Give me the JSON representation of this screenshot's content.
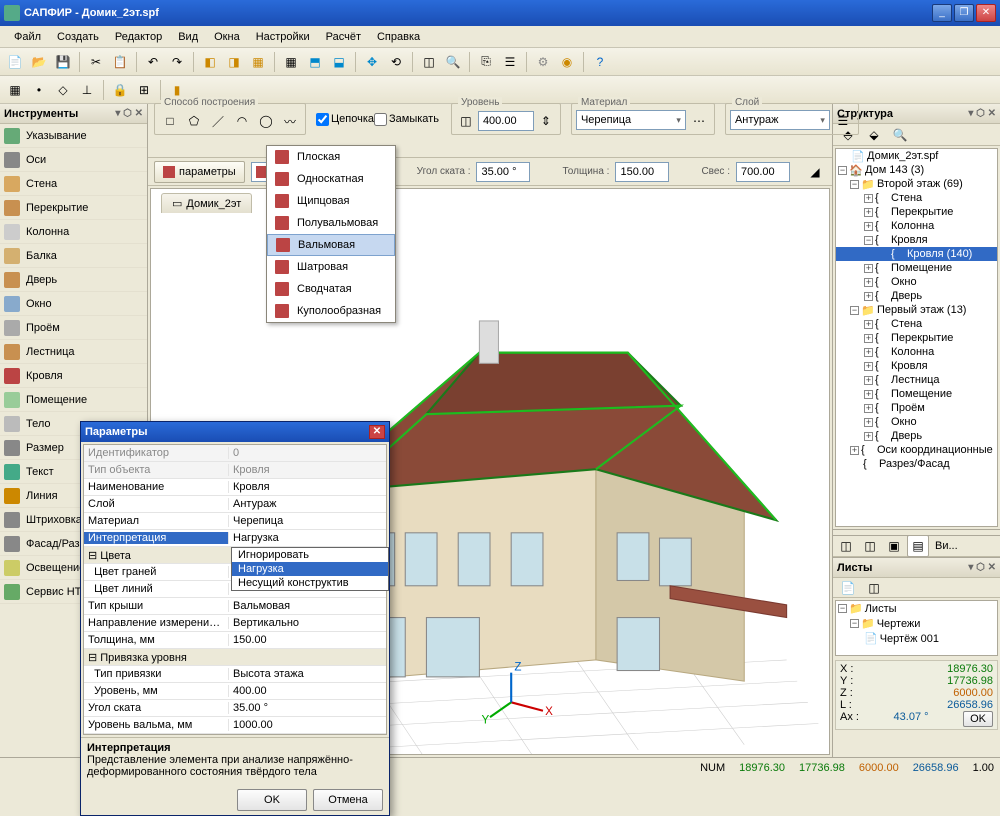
{
  "app": {
    "title": "САПФИР - Домик_2эт.spf"
  },
  "menu": [
    "Файл",
    "Создать",
    "Редактор",
    "Вид",
    "Окна",
    "Настройки",
    "Расчёт",
    "Справка"
  ],
  "instruments": {
    "title": "Инструменты",
    "items": [
      {
        "label": "Указывание",
        "color": "#6a7"
      },
      {
        "label": "Оси",
        "color": "#888"
      },
      {
        "label": "Стена",
        "color": "#d8a860"
      },
      {
        "label": "Перекрытие",
        "color": "#c89050"
      },
      {
        "label": "Колонна",
        "color": "#ccc"
      },
      {
        "label": "Балка",
        "color": "#d4b070"
      },
      {
        "label": "Дверь",
        "color": "#c89050"
      },
      {
        "label": "Окно",
        "color": "#8ac"
      },
      {
        "label": "Проём",
        "color": "#aaa"
      },
      {
        "label": "Лестница",
        "color": "#c89050"
      },
      {
        "label": "Кровля",
        "color": "#b44"
      },
      {
        "label": "Помещение",
        "color": "#9c9"
      },
      {
        "label": "Тело",
        "color": "#bbb"
      },
      {
        "label": "Размер",
        "color": "#888"
      },
      {
        "label": "Текст",
        "color": "#4a8"
      },
      {
        "label": "Линия",
        "color": "#c80"
      },
      {
        "label": "Штриховка",
        "color": "#888"
      },
      {
        "label": "Фасад/Разрез",
        "color": "#888"
      },
      {
        "label": "Освещение",
        "color": "#cc6"
      },
      {
        "label": "Сервис HTML",
        "color": "#6a6"
      }
    ]
  },
  "construction": {
    "label": "Способ построения",
    "chain": "Цепочка",
    "close": "Замыкать",
    "level_lbl": "Уровень",
    "level_val": "400.00",
    "material_lbl": "Материал",
    "material_val": "Черепица",
    "layer_lbl": "Слой",
    "layer_val": "Антураж"
  },
  "params_row": {
    "btn": "параметры",
    "type_val": "Вальмовая",
    "slope_lbl": "Угол ската :",
    "slope_val": "35.00 °",
    "thick_lbl": "Толщина :",
    "thick_val": "150.00",
    "over_lbl": "Свес :",
    "over_val": "700.00"
  },
  "roof_types": [
    "Плоская",
    "Односкатная",
    "Щипцовая",
    "Полувальмовая",
    "Вальмовая",
    "Шатровая",
    "Сводчатая",
    "Куполообразная"
  ],
  "viewport": {
    "tab": "Домик_2эт"
  },
  "structure": {
    "title": "Структура",
    "root": "Домик_2эт.spf",
    "house": "Дом 143 (3)",
    "floor2": "Второй этаж (69)",
    "f2_items": [
      "Стена",
      "Перекрытие",
      "Колонна"
    ],
    "roof": "Кровля",
    "roof_item": "Кровля (140)",
    "f2_items2": [
      "Помещение",
      "Окно",
      "Дверь"
    ],
    "floor1": "Первый этаж (13)",
    "f1_items": [
      "Стена",
      "Перекрытие",
      "Колонна",
      "Кровля",
      "Лестница",
      "Помещение",
      "Проём",
      "Окно",
      "Дверь"
    ],
    "axes": "Оси координационные",
    "section": "Разрез/Фасад"
  },
  "sheets": {
    "title": "Листы",
    "root": "Листы",
    "draw": "Чертежи",
    "item": "Чертёж 001",
    "tab": "Ви..."
  },
  "coords": {
    "x_lbl": "X :",
    "x": "18976.30",
    "y_lbl": "Y :",
    "y": "17736.98",
    "z_lbl": "Z :",
    "z": "6000.00",
    "l_lbl": "L :",
    "l": "26658.96",
    "a_lbl": "Ax :",
    "a": "43.07 °",
    "ok": "OK"
  },
  "status": {
    "num": "NUM",
    "v1": "18976.30",
    "v2": "17736.98",
    "v3": "6000.00",
    "v4": "26658.96",
    "v5": "1.00"
  },
  "dialog": {
    "title": "Параметры",
    "rows_top": [
      {
        "n": "Идентификатор",
        "v": "0",
        "dis": true
      },
      {
        "n": "Тип объекта",
        "v": "Кровля",
        "dis": true
      },
      {
        "n": "Наименование",
        "v": "Кровля"
      },
      {
        "n": "Слой",
        "v": "Антураж"
      },
      {
        "n": "Материал",
        "v": "Черепица"
      }
    ],
    "interp_n": "Интерпретация",
    "interp_v": "Нагрузка",
    "interp_opts": [
      "Игнорировать",
      "Нагрузка",
      "Несущий конструктив"
    ],
    "colors_grp": "Цвета",
    "colors": [
      {
        "n": "Цвет граней",
        "v": ""
      },
      {
        "n": "Цвет линий",
        "v": ""
      }
    ],
    "rows_mid": [
      {
        "n": "Тип крыши",
        "v": "Вальмовая"
      },
      {
        "n": "Направление измерения тол...",
        "v": "Вертикально"
      },
      {
        "n": "Толщина, мм",
        "v": "150.00"
      }
    ],
    "level_grp": "Привязка уровня",
    "level_rows": [
      {
        "n": "Тип привязки",
        "v": "Высота этажа"
      },
      {
        "n": "Уровень, мм",
        "v": "400.00"
      }
    ],
    "rows_bot": [
      {
        "n": "Угол ската",
        "v": "35.00 °"
      },
      {
        "n": "Уровень вальма, мм",
        "v": "1000.00"
      }
    ],
    "desc_t": "Интерпретация",
    "desc": "Представление элемента при анализе напряжённо-деформированного состояния твёрдого тела",
    "ok": "OK",
    "cancel": "Отмена"
  }
}
